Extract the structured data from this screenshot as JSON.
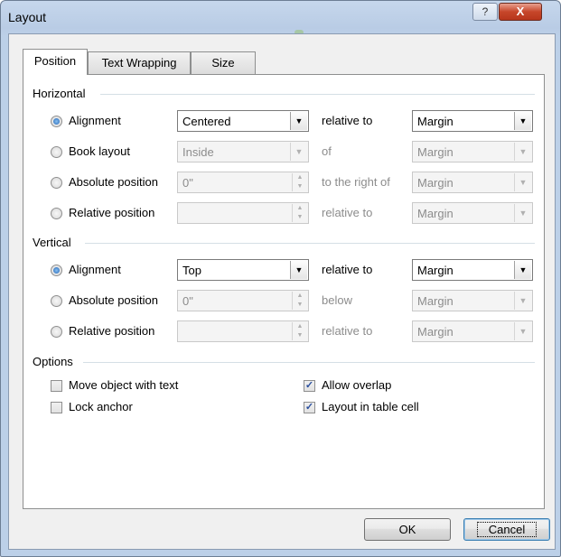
{
  "window": {
    "title": "Layout",
    "help_glyph": "?",
    "close_glyph": "X"
  },
  "tabs": [
    {
      "label": "Position",
      "active": true
    },
    {
      "label": "Text Wrapping",
      "active": false
    },
    {
      "label": "Size",
      "active": false
    }
  ],
  "horizontal": {
    "title": "Horizontal",
    "rows": [
      {
        "label": "Alignment",
        "checked": true,
        "value": "Centered",
        "kind": "combo",
        "enabled": true,
        "rel_label": "relative to",
        "rel_value": "Margin"
      },
      {
        "label": "Book layout",
        "checked": false,
        "value": "Inside",
        "kind": "combo",
        "enabled": false,
        "rel_label": "of",
        "rel_value": "Margin"
      },
      {
        "label": "Absolute position",
        "checked": false,
        "value": "0\"",
        "kind": "spin",
        "enabled": false,
        "rel_label": "to the right of",
        "rel_value": "Margin"
      },
      {
        "label": "Relative position",
        "checked": false,
        "value": "",
        "kind": "spin",
        "enabled": false,
        "rel_label": "relative to",
        "rel_value": "Margin"
      }
    ]
  },
  "vertical": {
    "title": "Vertical",
    "rows": [
      {
        "label": "Alignment",
        "checked": true,
        "value": "Top",
        "kind": "combo",
        "enabled": true,
        "rel_label": "relative to",
        "rel_value": "Margin"
      },
      {
        "label": "Absolute position",
        "checked": false,
        "value": "0\"",
        "kind": "spin",
        "enabled": false,
        "rel_label": "below",
        "rel_value": "Margin"
      },
      {
        "label": "Relative position",
        "checked": false,
        "value": "",
        "kind": "spin",
        "enabled": false,
        "rel_label": "relative to",
        "rel_value": "Margin"
      }
    ]
  },
  "options": {
    "title": "Options",
    "move_object": {
      "label": "Move object with text",
      "checked": false
    },
    "lock_anchor": {
      "label": "Lock anchor",
      "checked": false
    },
    "allow_overlap": {
      "label": "Allow overlap",
      "checked": true
    },
    "layout_in_cell": {
      "label": "Layout in table cell",
      "checked": true
    }
  },
  "buttons": {
    "ok": "OK",
    "cancel": "Cancel"
  },
  "colors": {
    "accent": "#2164b6",
    "disabled_text": "#8c8c8c",
    "close": "#c7462a"
  }
}
